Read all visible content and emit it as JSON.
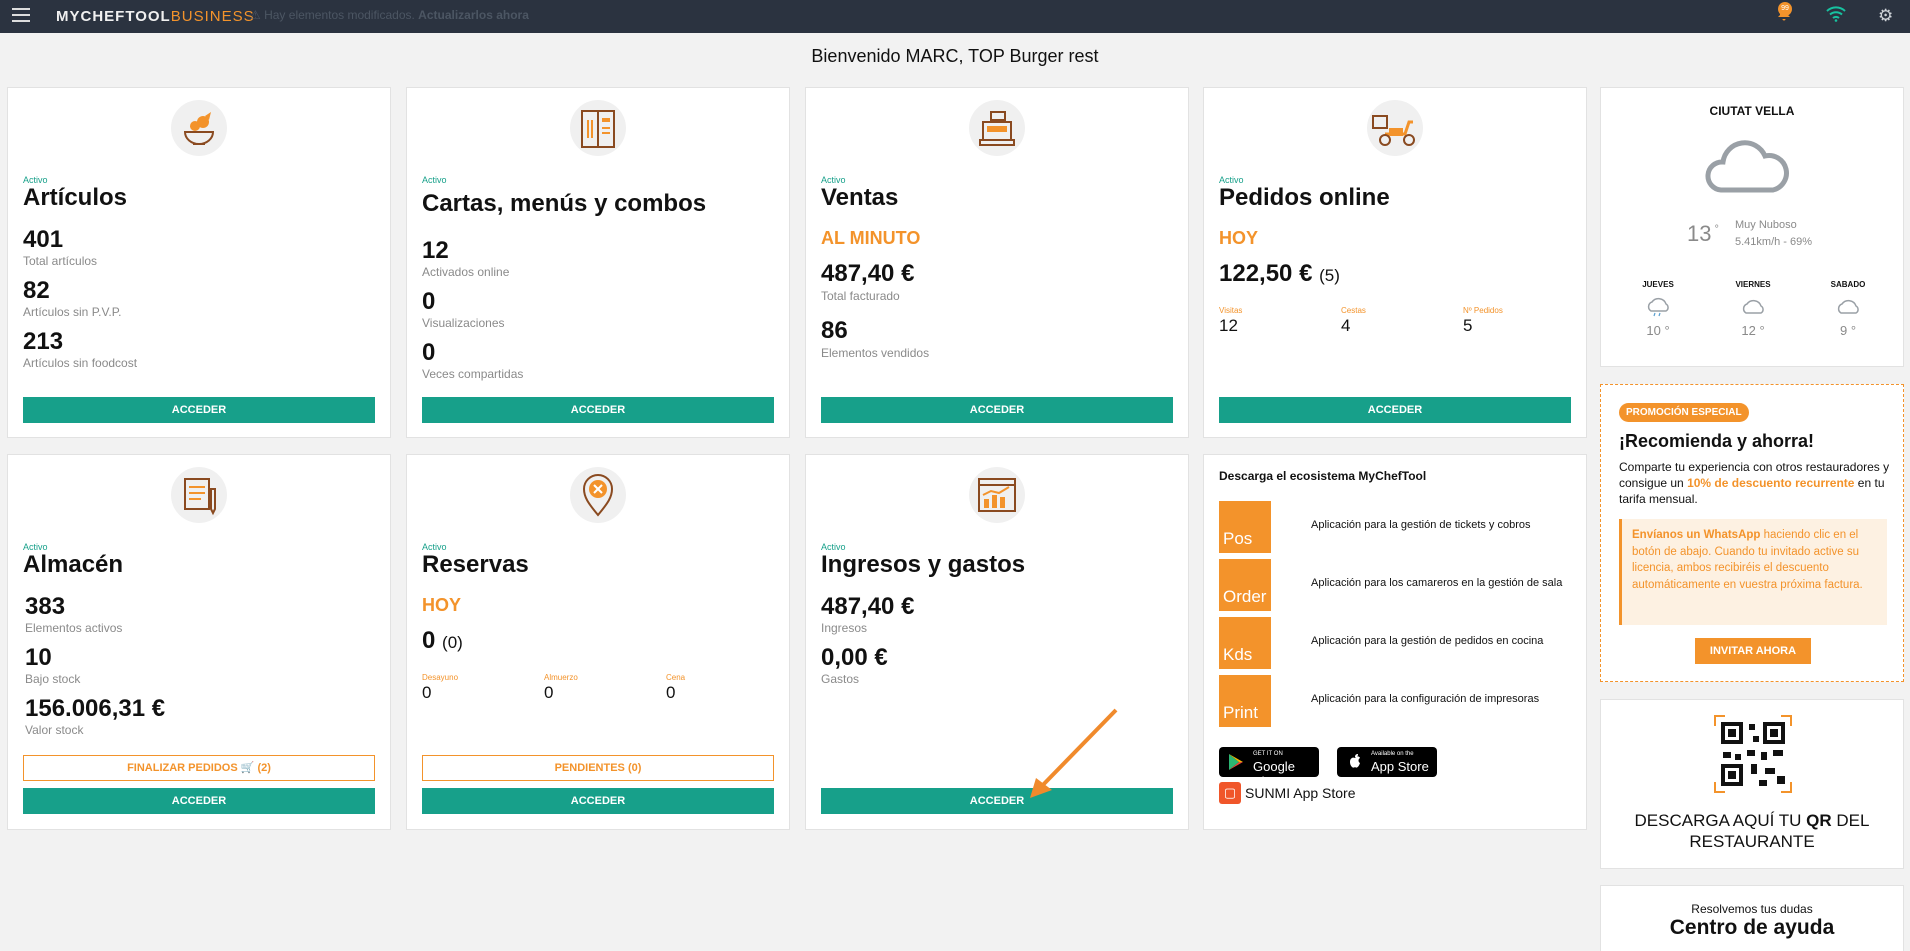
{
  "topbar": {
    "logo_part1": "MYCHEFTOOL",
    "logo_part2": "BUSINESS",
    "notice_text": "⚠ Hay elementos modificados",
    "notice_link": "Actualizarlos ahora",
    "notification_count": "99"
  },
  "welcome": "Bienvenido MARC, TOP Burger rest",
  "cards": {
    "articulos": {
      "status": "Activo",
      "title": "Artículos",
      "s1_val": "401",
      "s1_lbl": "Total artículos",
      "s2_val": "82",
      "s2_lbl": "Artículos sin P.V.P.",
      "s3_val": "213",
      "s3_lbl": "Artículos sin foodcost",
      "button": "ACCEDER"
    },
    "cartas": {
      "status": "Activo",
      "title": "Cartas, menús y combos",
      "s1_val": "12",
      "s1_lbl": "Activados online",
      "s2_val": "0",
      "s2_lbl": "Visualizaciones",
      "s3_val": "0",
      "s3_lbl": "Veces compartidas",
      "button": "ACCEDER"
    },
    "ventas": {
      "status": "Activo",
      "title": "Ventas",
      "period": "AL MINUTO",
      "s1_val": "487,40 €",
      "s1_lbl": "Total facturado",
      "s2_val": "86",
      "s2_lbl": "Elementos vendidos",
      "button": "ACCEDER"
    },
    "pedidos": {
      "status": "Activo",
      "title": "Pedidos online",
      "period": "HOY",
      "amount": "122,50 €",
      "count": "(5)",
      "m1_lbl": "Visitas",
      "m1_val": "12",
      "m2_lbl": "Cestas",
      "m2_val": "4",
      "m3_lbl": "Nº Pedidos",
      "m3_val": "5",
      "button": "ACCEDER"
    },
    "almacen": {
      "status": "Activo",
      "title": "Almacén",
      "s1_val": "383",
      "s1_lbl": "Elementos activos",
      "s2_val": "10",
      "s2_lbl": "Bajo stock",
      "s3_val": "156.006,31 €",
      "s3_lbl": "Valor stock",
      "outline_button": "FINALIZAR PEDIDOS 🛒 (2)",
      "button": "ACCEDER"
    },
    "reservas": {
      "status": "Activo",
      "title": "Reservas",
      "period": "HOY",
      "amount": "0",
      "count": "(0)",
      "m1_lbl": "Desayuno",
      "m1_val": "0",
      "m2_lbl": "Almuerzo",
      "m2_val": "0",
      "m3_lbl": "Cena",
      "m3_val": "0",
      "outline_button": "PENDIENTES (0)",
      "button": "ACCEDER"
    },
    "ingresos": {
      "status": "Activo",
      "title": "Ingresos y gastos",
      "s1_val": "487,40 €",
      "s1_lbl": "Ingresos",
      "s2_val": "0,00 €",
      "s2_lbl": "Gastos",
      "button": "ACCEDER"
    }
  },
  "eco": {
    "title": "Descarga el ecosistema MyChefTool",
    "apps": [
      {
        "name": "Pos",
        "desc": "Aplicación para la gestión de tickets y cobros"
      },
      {
        "name": "Order",
        "desc": "Aplicación para los camareros en la gestión de sala"
      },
      {
        "name": "Kds",
        "desc": "Aplicación para la gestión de pedidos en cocina"
      },
      {
        "name": "Print",
        "desc": "Aplicación para la configuración de impresoras"
      }
    ],
    "google_small": "GET IT ON",
    "google_big": "Google Play",
    "apple_small": "Available on the",
    "apple_big": "App Store",
    "sunmi": "SUNMI App Store"
  },
  "weather": {
    "city": "CIUTAT VELLA",
    "temp": "13",
    "condition": "Muy Nuboso",
    "wind": "5.41km/h - 69%",
    "forecast": [
      {
        "day": "JUEVES",
        "temp": "10"
      },
      {
        "day": "VIERNES",
        "temp": "12"
      },
      {
        "day": "SABADO",
        "temp": "9"
      }
    ]
  },
  "promo": {
    "tag": "PROMOCIÓN ESPECIAL",
    "title": "¡Recomienda y ahorra!",
    "text_a": "Comparte tu experiencia con otros restauradores y consigue un ",
    "text_highlight": "10% de descuento recurrente",
    "text_b": " en tu tarifa mensual.",
    "box_bold": "Envíanos un WhatsApp",
    "box_text": " haciendo clic en el botón de abajo. Cuando tu invitado active su licencia, ambos recibiréis el descuento automáticamente en vuestra próxima factura.",
    "button": "INVITAR AHORA"
  },
  "qr": {
    "text_a": "DESCARGA AQUÍ TU ",
    "text_bold": "QR",
    "text_b": " DEL RESTAURANTE"
  },
  "help": {
    "subtitle": "Resolvemos tus dudas",
    "title": "Centro de ayuda"
  },
  "colors": {
    "teal": "#17a08a",
    "orange": "#f3932b",
    "topbar": "#2b3340"
  }
}
